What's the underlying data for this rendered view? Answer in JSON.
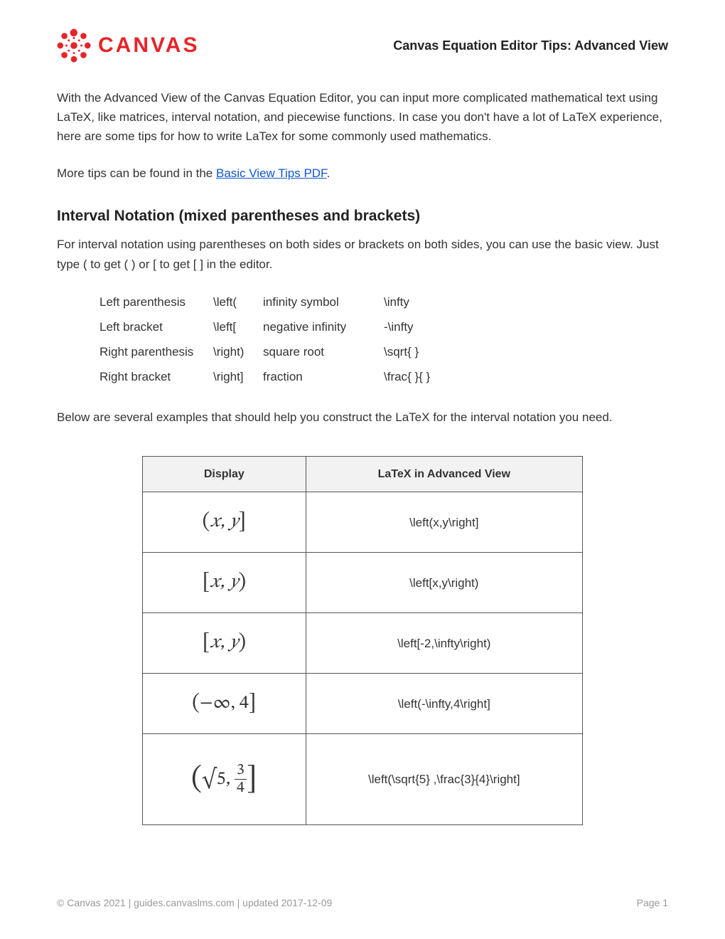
{
  "header": {
    "brand": "CANVAS",
    "doc_title": "Canvas Equation Editor Tips: Advanced View"
  },
  "intro": "With the Advanced View of the Canvas Equation Editor, you can input more complicated mathematical text using LaTeX, like matrices, interval notation, and piecewise functions. In case you don't have a lot of LaTeX experience, here are some tips for how to write LaTex for some commonly used mathematics.",
  "more_tips_prefix": "More tips can be found in the ",
  "more_tips_link": "Basic View Tips PDF",
  "more_tips_suffix": ".",
  "section1": {
    "title": "Interval Notation (mixed parentheses and brackets)",
    "desc": "For interval notation using parentheses on both sides or brackets on both sides, you can use the basic view. Just type ( to get ( ) or [ to get [ ] in the editor."
  },
  "symbols": [
    {
      "l1": "Left parenthesis",
      "l2": "\\left(",
      "l3": "infinity symbol",
      "l4": "\\infty"
    },
    {
      "l1": "Left bracket",
      "l2": "\\left[",
      "l3": "negative infinity",
      "l4": "-\\infty"
    },
    {
      "l1": "Right parenthesis",
      "l2": "\\right)",
      "l3": "square root",
      "l4": "\\sqrt{ }"
    },
    {
      "l1": "Right bracket",
      "l2": "\\right]",
      "l3": "fraction",
      "l4": "\\frac{ }{ }"
    }
  ],
  "below_desc": "Below are several examples that should help you construct the LaTeX for the interval notation you need.",
  "examples": {
    "headers": {
      "display": "Display",
      "latex": "LaTeX in Advanced View"
    },
    "rows": [
      {
        "display_html": "<span class='lparen'>(</span>𝑥, 𝑦<span class='rbrack'>]</span>",
        "latex": "\\left(x,y\\right]"
      },
      {
        "display_html": "<span class='lbrack'>[</span>𝑥, 𝑦<span class='rparen'>)</span>",
        "latex": "\\left[x,y\\right)"
      },
      {
        "display_html": "<span class='lbrack'>[</span>𝑥, 𝑦<span class='rparen'>)</span>",
        "latex": "\\left[-2,\\infty\\right)"
      },
      {
        "display_html": "<span class='lparen'>(</span><span class='roman'>−∞, 4</span><span class='rbrack'>]</span>",
        "latex": "\\left(-\\infty,4\\right]"
      },
      {
        "display_html": "<span class='lparen big'>(</span><span class='roman'>√5</span>, <span class='frac'><span class='num'>3</span><span class='den'>4</span></span><span class='rbrack big'>]</span>",
        "latex": "\\left(\\sqrt{5} ,\\frac{3}{4}\\right]",
        "tall": true
      }
    ]
  },
  "footer": {
    "left": "© Canvas 2021 | guides.canvaslms.com | updated 2017-12-09",
    "right": "Page 1"
  }
}
